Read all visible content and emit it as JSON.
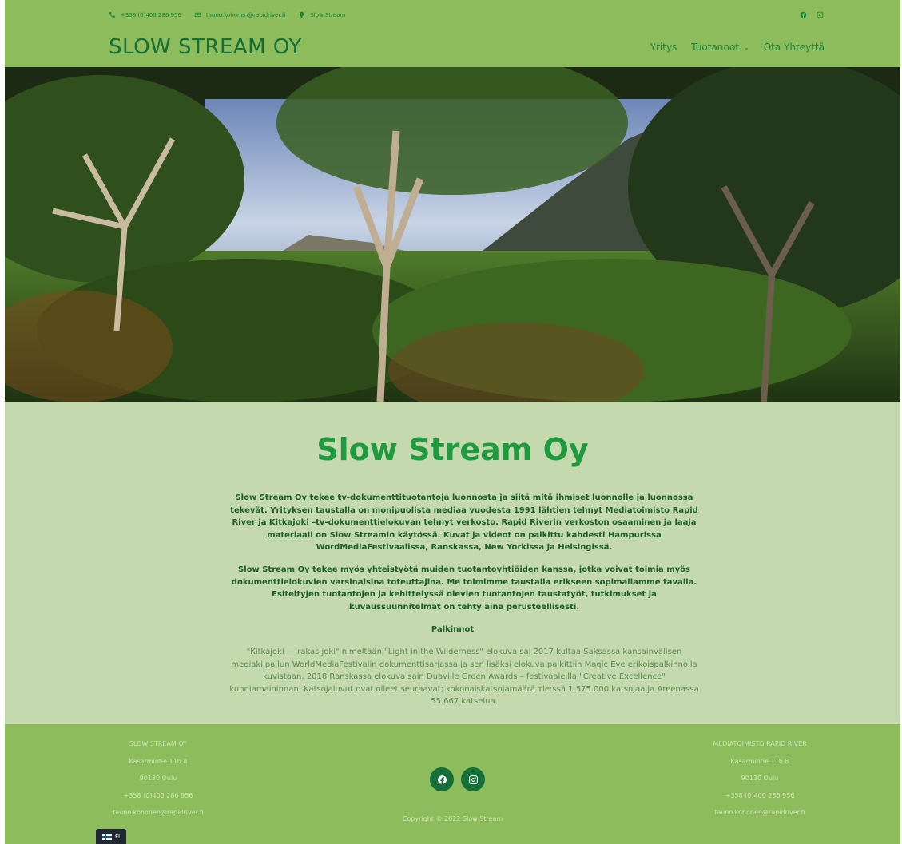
{
  "header": {
    "contact": {
      "phone": "+358 (0)400 286 956",
      "email": "tauno.kohonen@rapidriver.fi",
      "location": "Slow Stream"
    },
    "brand": "SLOW STREAM OY",
    "nav": {
      "items": [
        {
          "label": "Yritys"
        },
        {
          "label": "Tuotannot",
          "caret": "⌄"
        },
        {
          "label": "Ota Yhteyttä"
        }
      ]
    },
    "social_icons": [
      "facebook-icon",
      "instagram-icon"
    ]
  },
  "hero": {
    "image": "forest-mountain-hero"
  },
  "main": {
    "title": "Slow Stream Oy",
    "paragraphs": [
      "Slow Stream Oy tekee tv-dokumenttituotantoja luonnosta ja siitä mitä ihmiset luonnolle ja luonnossa tekevät. Yrityksen taustalla on monipuolista mediaa vuodesta 1991 lähtien tehnyt Mediatoimisto Rapid River ja Kitkajoki –tv-dokumenttielokuvan tehnyt verkosto. Rapid Riverin verkoston osaaminen ja laaja materiaali on Slow Streamin käytössä. Kuvat ja videot on palkittu kahdesti Hampurissa WordMediaFestivaalissa, Ranskassa, New Yorkissa ja Helsingissä.",
      "Slow Stream Oy tekee myös yhteistyötä muiden tuotantoyhtiöiden kanssa, jotka voivat toimia myös dokumenttielokuvien varsinaisina toteuttajina. Me toimimme taustalla erikseen sopimallamme tavalla. Esiteltyjen tuotantojen ja kehittelyssä olevien tuotantojen taustatyöt, tutkimukset ja kuvaussuunnitelmat on tehty aina perusteellisesti."
    ],
    "awards_heading": "Palkinnot",
    "awards_text": "\"Kitkajoki — rakas joki\" nimeltään \"Light in the Wilderness\" elokuva sai 2017 kultaa Saksassa kansainvälisen mediakilpailun WorldMediaFestivalin dokumenttisarjassa ja sen lisäksi elokuva palkittiin Magic Eye erikoispalkinnolla kuvistaan. 2018 Ranskassa elokuva sain Duaville Green Awards – festivaaleilla \"Creative Excellence\" kunniamaininnan. Katsojaluvut ovat olleet seuraavat; kokonaiskatsojamäärä Yle:ssä 1.575.000 katsojaa ja Areenassa 55.667 katselua."
  },
  "footer": {
    "left": {
      "name": "SLOW STREAM OY",
      "street": "Kasarmintie 11b 8",
      "city": "90130 Oulu",
      "phone": "+358 (0)400 286 956",
      "email": "tauno.kohonen@rapidriver.fi"
    },
    "right": {
      "name": "MEDIATOIMISTO RAPID RIVER",
      "street": "Kasarmintie 11b 8",
      "city": "90130 Oulu",
      "phone": "+358 (0)400 286 956",
      "email": "tauno.kohonen@rapidriver.fi"
    },
    "copyright": "Copyright © 2022 Slow Stream",
    "social_icons": [
      "facebook-icon",
      "instagram-icon"
    ]
  },
  "language_switcher": {
    "label": "FI",
    "flag": "finland-flag-icon"
  },
  "colors": {
    "header_bg": "#8cbc5b",
    "content_bg": "#c5d9ae",
    "brand_green": "#166f38",
    "title_green": "#1f9a3f"
  }
}
